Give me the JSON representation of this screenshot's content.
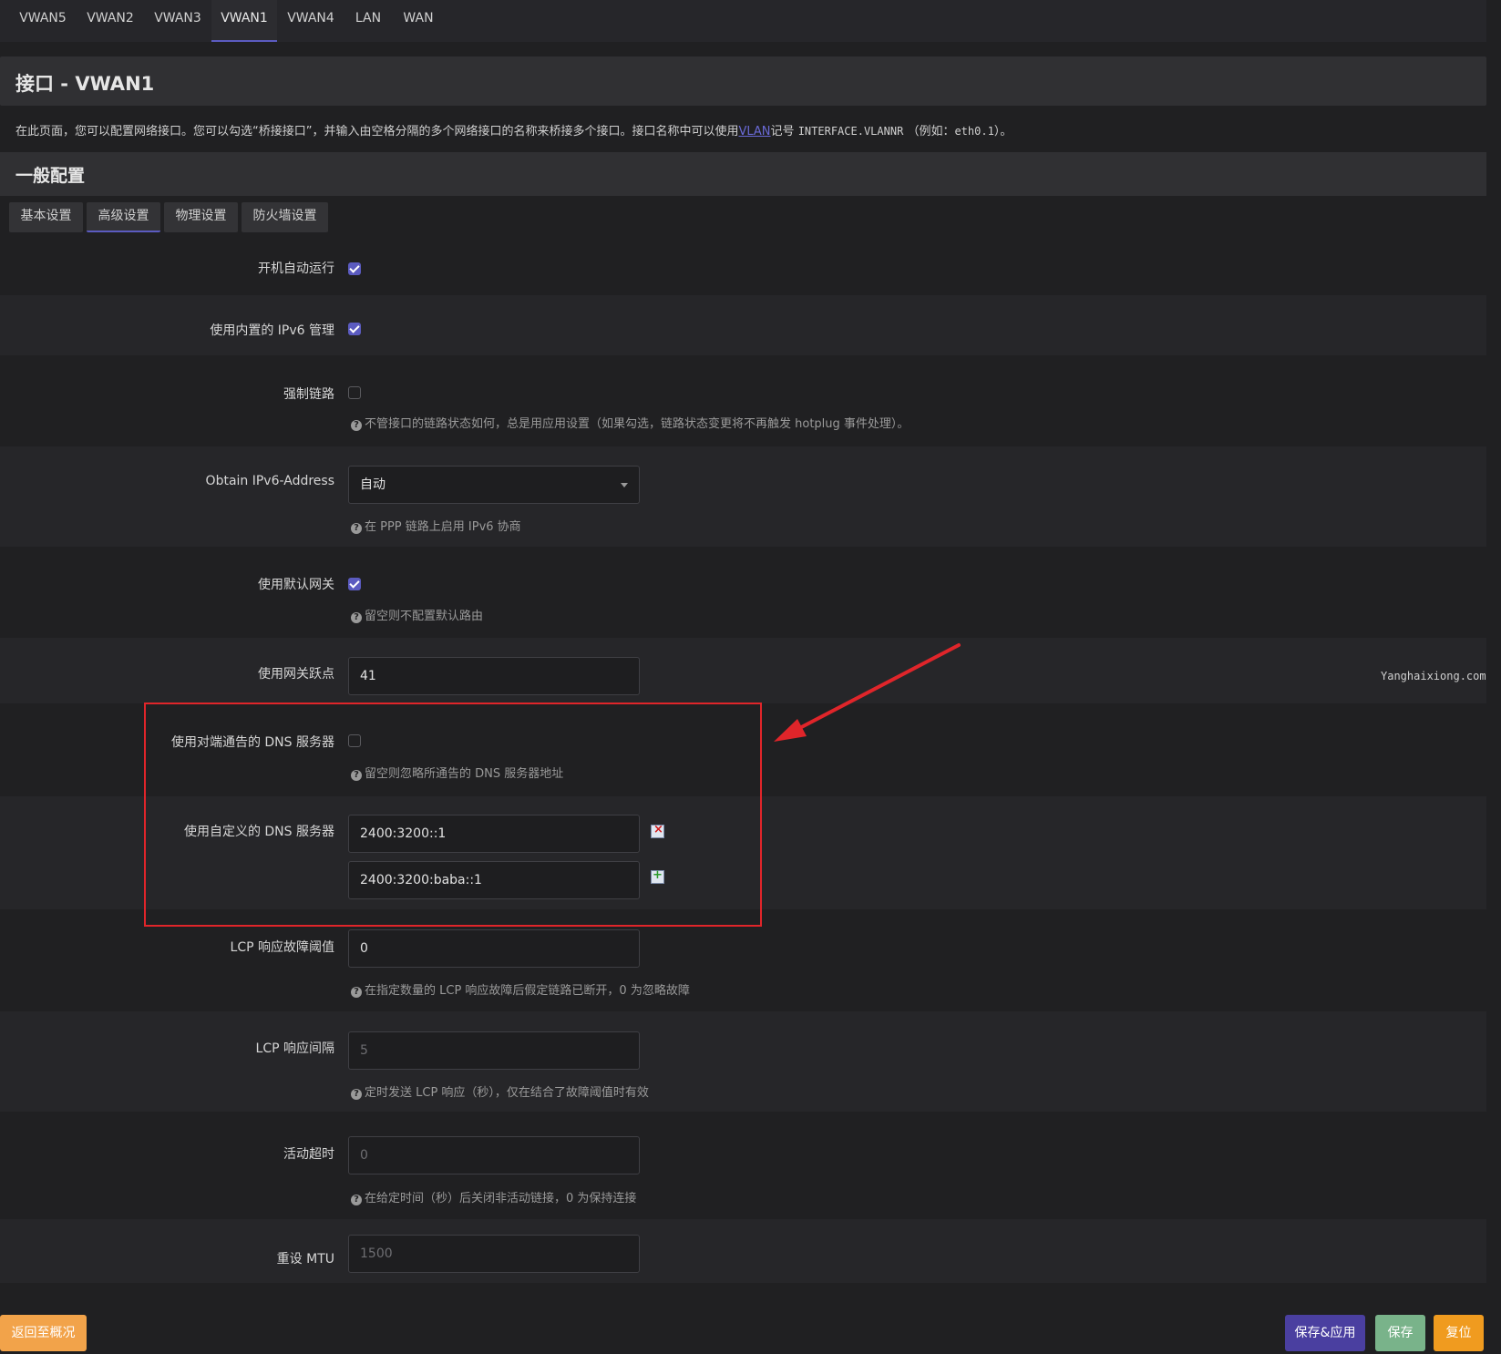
{
  "tabs": [
    "VWAN5",
    "VWAN2",
    "VWAN3",
    "VWAN1",
    "VWAN4",
    "LAN",
    "WAN"
  ],
  "active_tab": "VWAN1",
  "page": {
    "title": "接口 - VWAN1",
    "desc_before": "在此页面，您可以配置网络接口。您可以勾选“桥接接口”，并输入由空格分隔的多个网络接口的名称来桥接多个接口。接口名称中可以使用",
    "desc_link": "VLAN",
    "desc_mid": "记号",
    "desc_code1": "INTERFACE.VLANNR",
    "desc_mid2": "（例如：",
    "desc_code2": "eth0.1",
    "desc_after": "）。"
  },
  "section": {
    "title": "一般配置"
  },
  "subtabs": [
    "基本设置",
    "高级设置",
    "物理设置",
    "防火墙设置"
  ],
  "active_subtab": "高级设置",
  "fields": {
    "autostart": {
      "label": "开机自动运行",
      "checked": true
    },
    "ipv6_builtin": {
      "label": "使用内置的 IPv6 管理",
      "checked": true
    },
    "force_link": {
      "label": "强制链路",
      "checked": false,
      "help": "不管接口的链路状态如何，总是用应用设置（如果勾选，链路状态变更将不再触发 hotplug 事件处理）。"
    },
    "obtain_ipv6": {
      "label": "Obtain IPv6-Address",
      "value": "自动",
      "help": "在 PPP 链路上启用 IPv6 协商"
    },
    "default_gw": {
      "label": "使用默认网关",
      "checked": true,
      "help": "留空则不配置默认路由"
    },
    "gw_metric": {
      "label": "使用网关跃点",
      "value": "41"
    },
    "peer_dns": {
      "label": "使用对端通告的 DNS 服务器",
      "checked": false,
      "help": "留空则忽略所通告的 DNS 服务器地址"
    },
    "custom_dns": {
      "label": "使用自定义的 DNS 服务器",
      "values": [
        "2400:3200::1",
        "2400:3200:baba::1"
      ]
    },
    "lcp_threshold": {
      "label": "LCP 响应故障阈值",
      "value": "0",
      "help": "在指定数量的 LCP 响应故障后假定链路已断开，0 为忽略故障"
    },
    "lcp_interval": {
      "label": "LCP 响应间隔",
      "placeholder": "5",
      "help": "定时发送 LCP 响应（秒），仅在结合了故障阈值时有效"
    },
    "idle_timeout": {
      "label": "活动超时",
      "placeholder": "0",
      "help": "在给定时间（秒）后关闭非活动链接，0 为保持连接"
    },
    "mtu": {
      "label": "重设 MTU",
      "placeholder": "1500"
    }
  },
  "watermark": "Yanghaixiong.com",
  "buttons": {
    "back": "返回至概况",
    "save_apply": "保存&应用",
    "save": "保存",
    "reset": "复位"
  },
  "colors": {
    "accent": "#5b5bc0",
    "highlight": "#e0252a",
    "arrow": "#e0252a"
  }
}
